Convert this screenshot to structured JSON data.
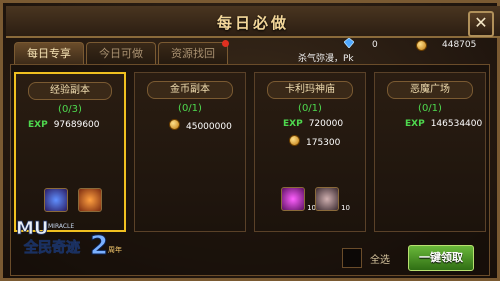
{
  "window": {
    "title": "每日必做",
    "close_icon": "close-icon"
  },
  "tabs": [
    {
      "label": "每日专享",
      "active": true
    },
    {
      "label": "今日可做",
      "active": false
    },
    {
      "label": "资源找回",
      "active": false,
      "has_notification": true
    }
  ],
  "resources": {
    "gem_value": "0",
    "gold_value": "448705",
    "marquee": "杀气弥漫，Pk"
  },
  "cards": [
    {
      "title": "经验副本",
      "count": "(0/3)",
      "exp_label": "EXP",
      "exp_value": "97689600",
      "selected": true,
      "items": [
        {
          "icon": "blue-potion-icon"
        },
        {
          "icon": "orange-orb-icon"
        }
      ]
    },
    {
      "title": "金币副本",
      "count": "(0/1)",
      "gold_value": "45000000"
    },
    {
      "title": "卡利玛神庙",
      "count": "(0/1)",
      "exp_label": "EXP",
      "exp_value": "720000",
      "gold_value": "175300",
      "items": [
        {
          "icon": "magenta-gem-icon",
          "qty": "10"
        },
        {
          "icon": "crystal-shard-icon",
          "qty": "10"
        }
      ]
    },
    {
      "title": "恶魔广场",
      "count": "(0/1)",
      "exp_label": "EXP",
      "exp_value": "146534400"
    }
  ],
  "logo": {
    "line1": "MU",
    "line2": "MIRACLE",
    "line3": "全民奇迹",
    "number": "2",
    "badge": "周年"
  },
  "footer": {
    "select_all_label": "全选",
    "claim_label": "一键领取"
  },
  "colors": {
    "accent_green": "#4ed84e",
    "selected_border": "#f0c020",
    "claim_button": "#4a9a28"
  }
}
